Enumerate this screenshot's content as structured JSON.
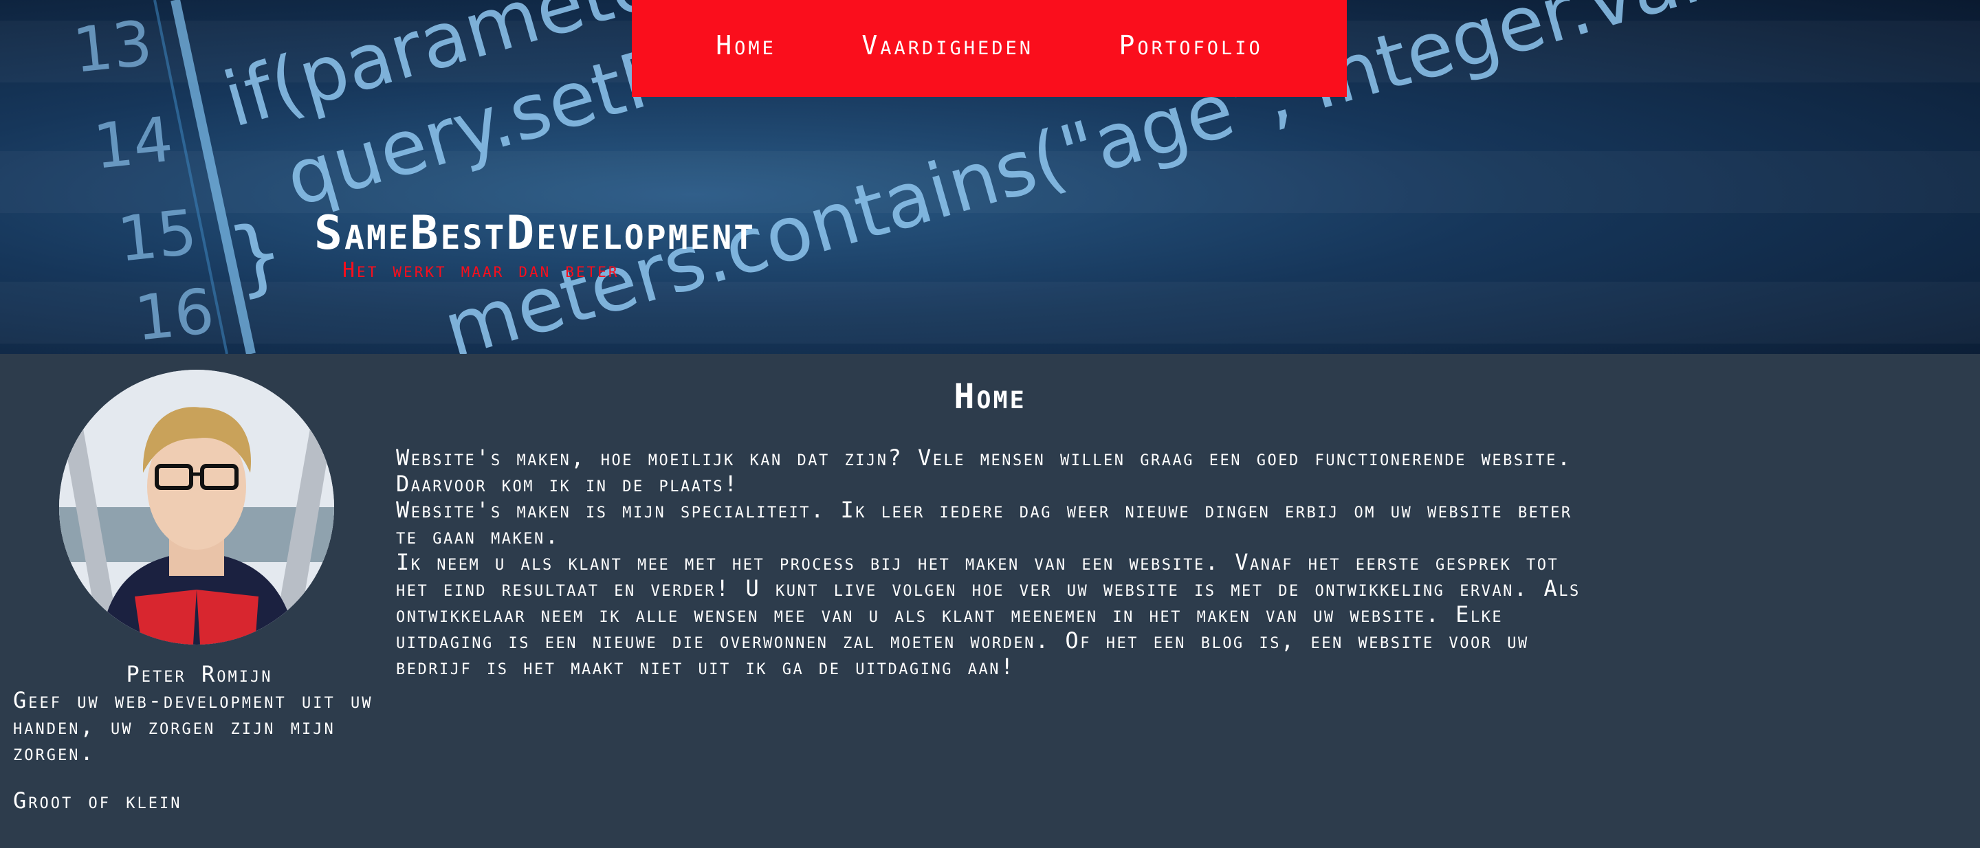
{
  "nav": {
    "items": [
      "Home",
      "Vaardigheden",
      "Portofolio"
    ]
  },
  "hero": {
    "site_title": "SameBestDevelopment",
    "tagline": "Het werkt maar dan beter",
    "code_lines": [
      {
        "num": "13",
        "code": "if(paramete"
      },
      {
        "num": "14",
        "code": "query.setP"
      },
      {
        "num": "15",
        "code": "}"
      },
      {
        "num": "16",
        "code": "meters.contains(\"age\", Integer.valueOf(valu"
      }
    ]
  },
  "sidebar": {
    "name": "Peter Romijn",
    "tagline": "Geef uw web-development uit uw handen, uw zorgen zijn mijn zorgen.",
    "extra": "Groot of klein"
  },
  "main": {
    "title": "Home",
    "paragraphs": [
      "Website's maken, hoe moeilijk kan dat zijn? Vele mensen willen graag een goed functionerende website. Daarvoor kom ik in de plaats!",
      "Website's maken is mijn specialiteit. Ik leer iedere dag weer nieuwe dingen erbij om uw website beter te gaan maken.",
      "Ik neem u als klant mee met het process bij het maken van een website. Vanaf het eerste gesprek tot het eind resultaat en verder! U kunt live volgen hoe ver uw website is met de ontwikkeling ervan. Als ontwikkelaar neem ik alle wensen mee van u als klant meenemen in het maken van uw website. Elke uitdaging is een nieuwe die overwonnen zal moeten worden. Of het een blog is, een website voor uw bedrijf is het maakt niet uit ik ga de uitdaging aan!"
    ]
  },
  "colors": {
    "accent": "#fa0e1c",
    "background": "#2d3c4c"
  }
}
